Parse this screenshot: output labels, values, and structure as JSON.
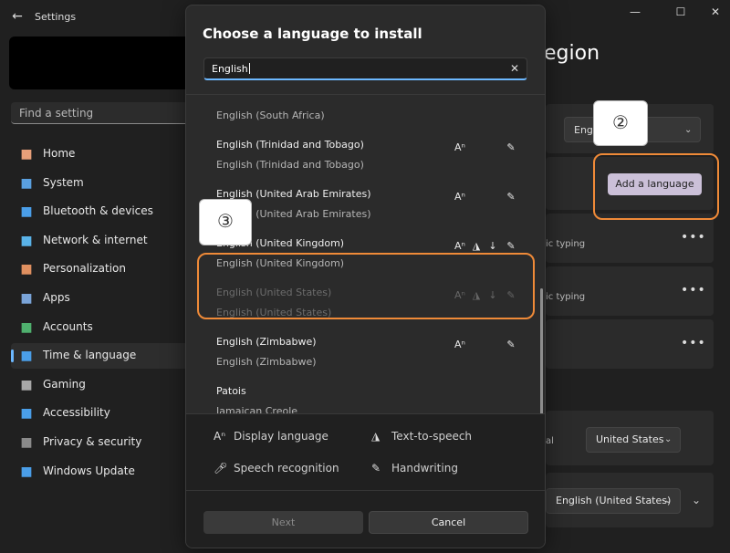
{
  "window": {
    "title": "Settings",
    "back_icon": "back-arrow-icon",
    "minimize": "—",
    "maximize": "☐",
    "close": "✕"
  },
  "sidebar": {
    "search_placeholder": "Find a setting",
    "items": [
      {
        "label": "Home",
        "icon": "home-icon",
        "color": "#e8a07a"
      },
      {
        "label": "System",
        "icon": "system-icon",
        "color": "#5aa0e0"
      },
      {
        "label": "Bluetooth & devices",
        "icon": "bluetooth-icon",
        "color": "#4a9ee8"
      },
      {
        "label": "Network & internet",
        "icon": "wifi-icon",
        "color": "#5ab3e8"
      },
      {
        "label": "Personalization",
        "icon": "brush-icon",
        "color": "#e09060"
      },
      {
        "label": "Apps",
        "icon": "apps-icon",
        "color": "#7aa4d8"
      },
      {
        "label": "Accounts",
        "icon": "accounts-icon",
        "color": "#4fb06e"
      },
      {
        "label": "Time & language",
        "icon": "clock-globe-icon",
        "color": "#4a9ee8",
        "active": true
      },
      {
        "label": "Gaming",
        "icon": "gamepad-icon",
        "color": "#a8a8a8"
      },
      {
        "label": "Accessibility",
        "icon": "accessibility-icon",
        "color": "#4a9ee8"
      },
      {
        "label": "Privacy & security",
        "icon": "shield-icon",
        "color": "#8a8a8a"
      },
      {
        "label": "Windows Update",
        "icon": "update-icon",
        "color": "#4a9ee8"
      }
    ]
  },
  "main": {
    "heading_fragment": "egion",
    "region_select_value": "Engl             ates)",
    "add_language_label": "Add a language",
    "typing_label_1": "ic typing",
    "typing_label_2": "ic typing",
    "more_label": "•••",
    "partial_label": "al",
    "select_2_value": "United States",
    "select_3_value": "English (United States)"
  },
  "annotations": {
    "step_2": "②",
    "step_3": "③"
  },
  "dialog": {
    "title": "Choose a language to install",
    "search_value": "English",
    "clear_icon": "✕",
    "languages": [
      {
        "name": "",
        "native": "English (South Africa)",
        "features": []
      },
      {
        "name": "English (Trinidad and Tobago)",
        "native": "English (Trinidad and Tobago)",
        "features": [
          "display-language",
          "handwriting"
        ]
      },
      {
        "name": "English (United Arab Emirates)",
        "native": "English (United Arab Emirates)",
        "features": [
          "display-language",
          "handwriting"
        ]
      },
      {
        "name": "English (United Kingdom)",
        "native": "English (United Kingdom)",
        "features": [
          "display-language",
          "text-to-speech",
          "speech-recognition",
          "handwriting"
        ]
      },
      {
        "name": "English (United States)",
        "native": "English (United States)",
        "features": [
          "display-language",
          "text-to-speech",
          "speech-recognition",
          "handwriting"
        ],
        "dim": true
      },
      {
        "name": "English (Zimbabwe)",
        "native": "English (Zimbabwe)",
        "features": [
          "display-language",
          "handwriting"
        ]
      },
      {
        "name": "Patois",
        "native": "Jamaican Creole",
        "features": []
      }
    ],
    "legend": {
      "display_language": "Display language",
      "text_to_speech": "Text-to-speech",
      "speech_recognition": "Speech recognition",
      "handwriting": "Handwriting"
    },
    "next_label": "Next",
    "cancel_label": "Cancel"
  },
  "colors": {
    "accent": "#6cb8ff",
    "callout": "#ef8a38",
    "add_language_bg": "#cbc0d8"
  }
}
